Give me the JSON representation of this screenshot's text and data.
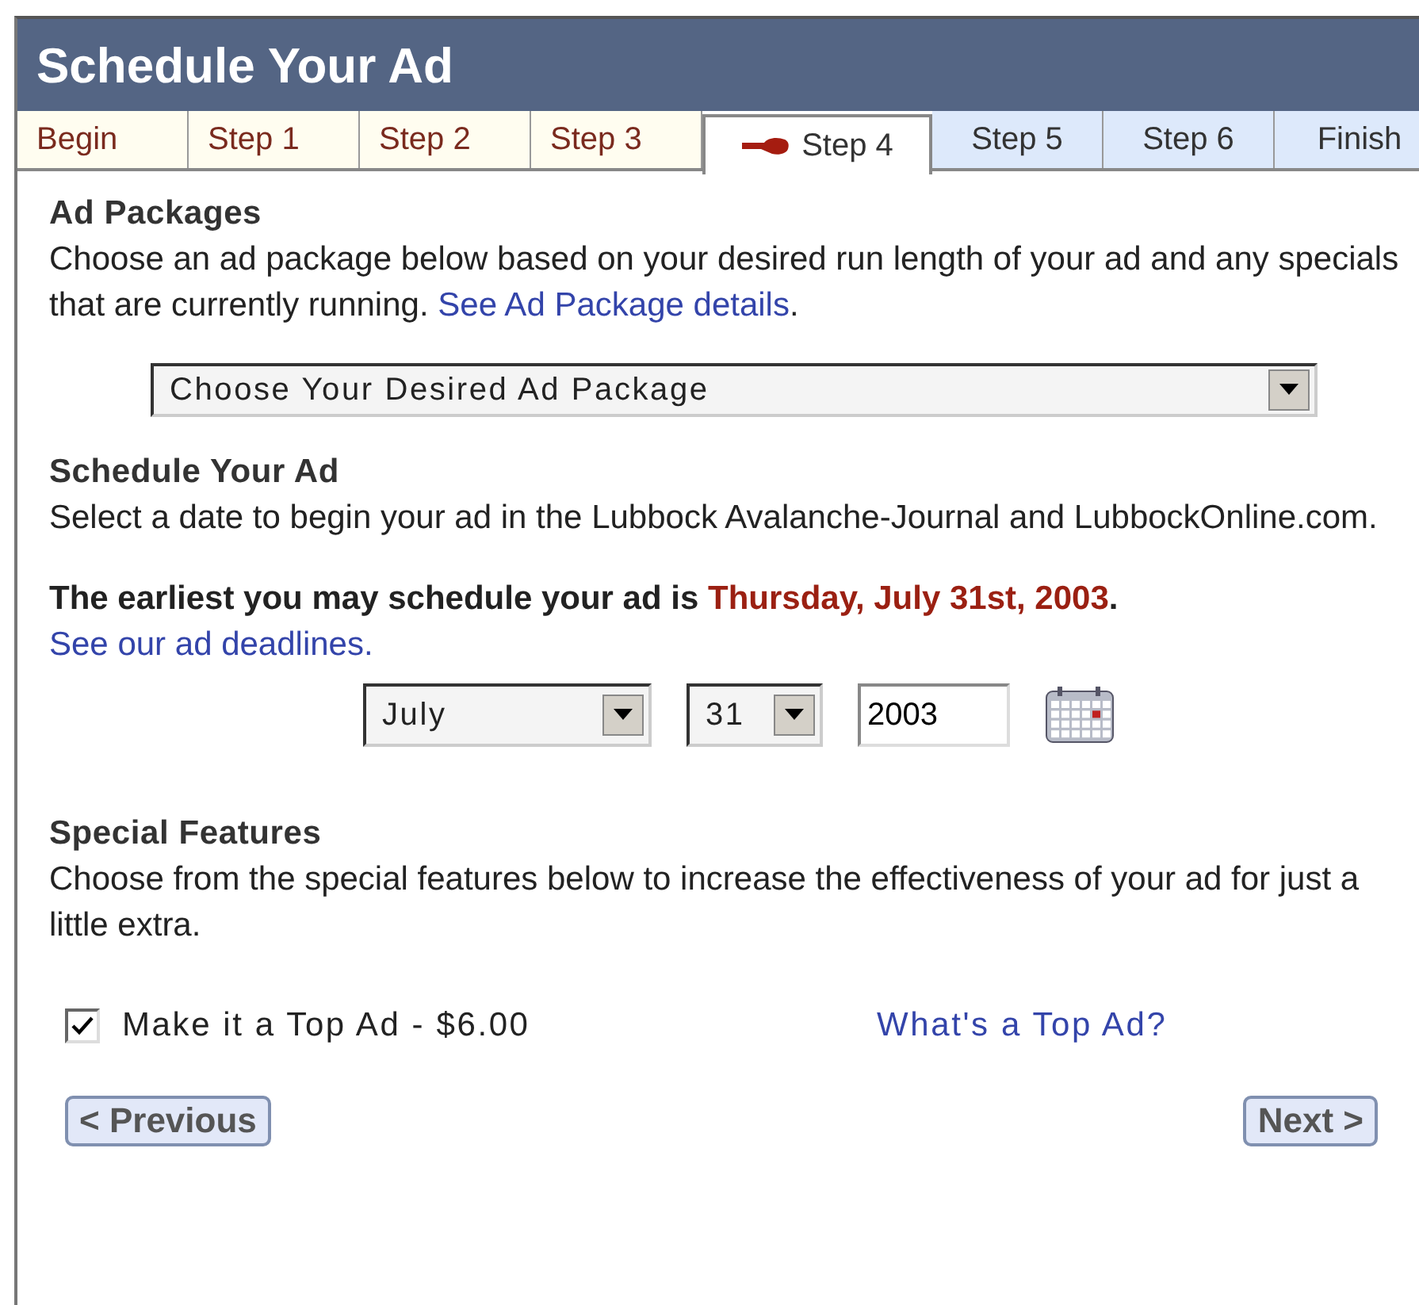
{
  "window": {
    "title": "Schedule Your Ad"
  },
  "tabs": [
    {
      "label": "Begin",
      "selected": false,
      "completed": true
    },
    {
      "label": "Step 1",
      "selected": false,
      "completed": true
    },
    {
      "label": "Step 2",
      "selected": false,
      "completed": true
    },
    {
      "label": "Step 3",
      "selected": false,
      "completed": true
    },
    {
      "label": "Step 4",
      "selected": true,
      "completed": false
    },
    {
      "label": "Step 5",
      "selected": false,
      "completed": false
    },
    {
      "label": "Step 6",
      "selected": false,
      "completed": false
    },
    {
      "label": "Finish",
      "selected": false,
      "completed": false
    }
  ],
  "packages": {
    "heading": "Ad Packages",
    "text": "Choose an ad package below based on your desired run length of your ad and any specials that are currently running.",
    "link": "See Ad Package details",
    "after_link": ".",
    "select": "Choose Your Desired Ad Package"
  },
  "schedule": {
    "heading": "Schedule Your Ad",
    "text": "Select a date to begin your ad in the Lubbock Avalanche-Journal and LubbockOnline.com.",
    "earliest_prefix": "The earliest you may schedule your ad is",
    "earliest_date": "Thursday, July 31st, 2003",
    "earliest_suffix": ".",
    "link": "See our ad deadlines.",
    "month": "July",
    "day": "31",
    "year": "2003"
  },
  "features": {
    "heading": "Special Features",
    "text": "Choose from the special features below to increase the effectiveness of your ad for just a little extra.",
    "options": [
      {
        "label": "Make it a Top Ad - $6.00",
        "checked": true,
        "link": "What's a Top Ad?"
      }
    ]
  },
  "buttons": {
    "previous": "< Previous",
    "next": "Next >"
  }
}
